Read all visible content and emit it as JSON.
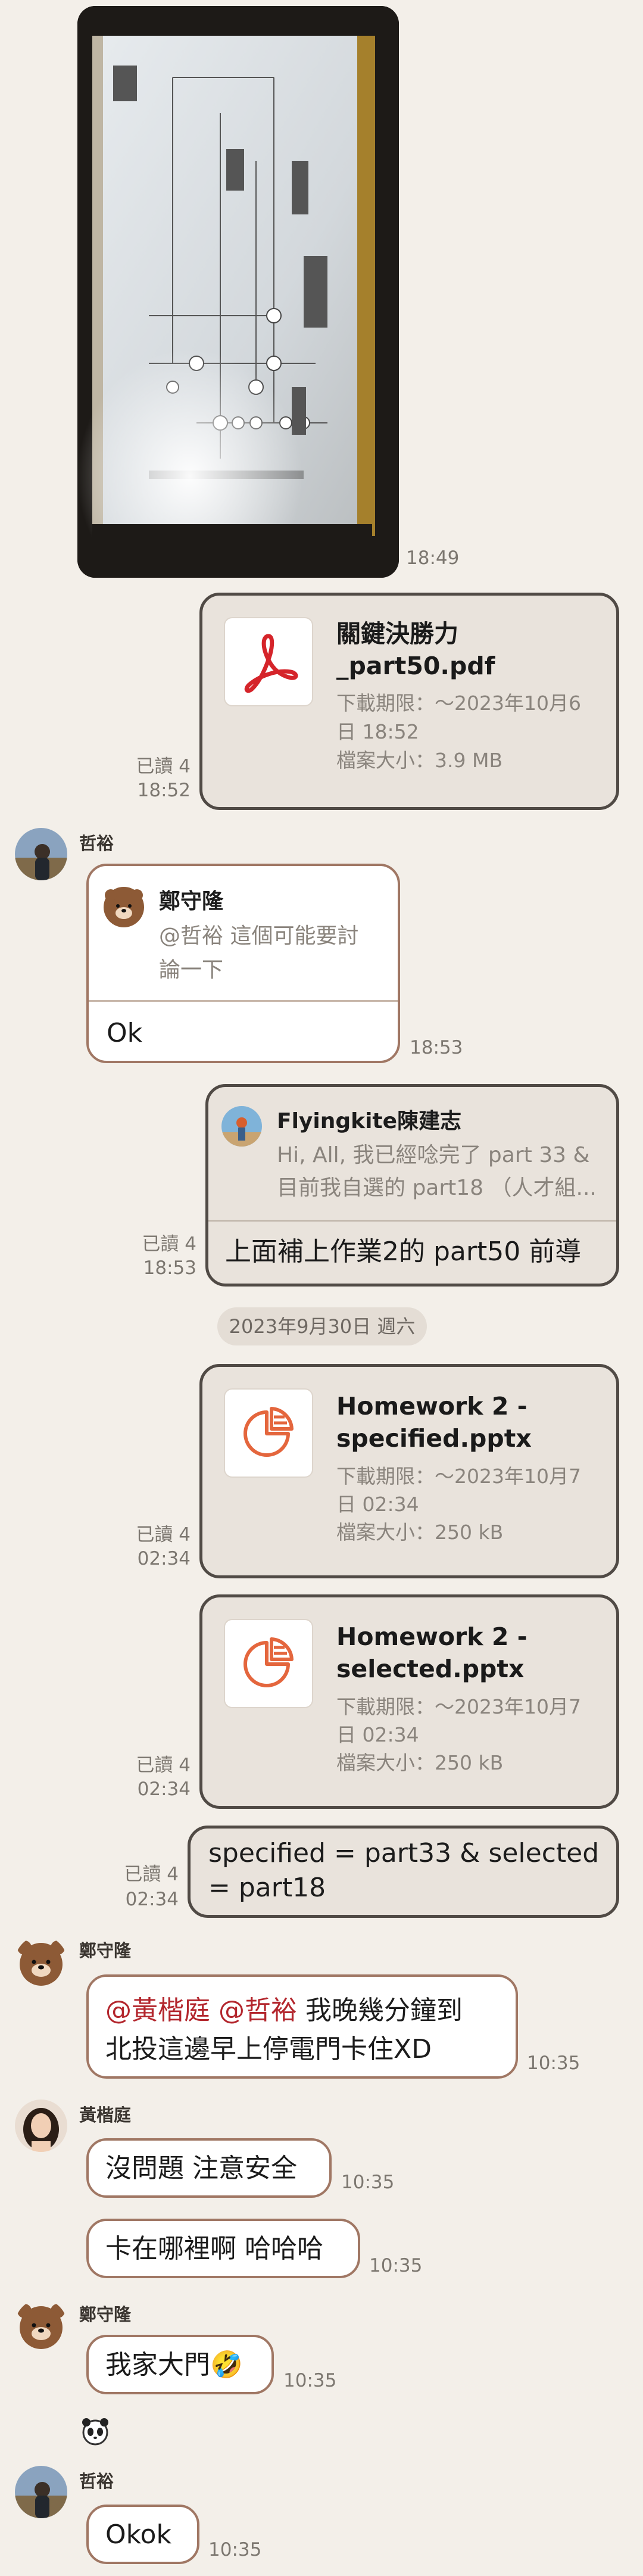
{
  "messages": {
    "photo": {
      "time": "18:49"
    },
    "pdf": {
      "read": "已讀 4",
      "time": "18:52",
      "title1": "關鍵決勝力",
      "title2": "_part50.pdf",
      "expiry1": "下載期限：～2023年10月6",
      "expiry2": "日 18:52",
      "size": "檔案大小：3.9 MB",
      "icon": "pdf-icon"
    },
    "zheyu_ok": {
      "sender": "哲裕",
      "quote_name": "鄭守隆",
      "quote_text1": "@哲裕 這個可能要討",
      "quote_text2": "論一下",
      "text": "Ok",
      "time": "18:53"
    },
    "reply_flying": {
      "read": "已讀 4",
      "time": "18:53",
      "quote_name": "Flyingkite陳建志",
      "quote_text1": "Hi, All, 我已經唸完了 part 33 &",
      "quote_text2": "目前我自選的 part18 （人才組...",
      "text": "上面補上作業2的 part50 前導"
    },
    "date_divider": "2023年9月30日 週六",
    "pptx1": {
      "read": "已讀 4",
      "time": "02:34",
      "title1": "Homework 2 -",
      "title2": "specified.pptx",
      "expiry1": "下載期限：～2023年10月7",
      "expiry2": "日 02:34",
      "size": "檔案大小：250 kB"
    },
    "pptx2": {
      "read": "已讀 4",
      "time": "02:34",
      "title1": "Homework 2 -",
      "title2": "selected.pptx",
      "expiry1": "下載期限：～2023年10月7",
      "expiry2": "日 02:34",
      "size": "檔案大小：250 kB"
    },
    "spec_text": {
      "read": "已讀 4",
      "time": "02:34",
      "line1": "specified = part33 & selected",
      "line2": "= part18"
    },
    "zheng1": {
      "sender": "鄭守隆",
      "mention1": "@黃楷庭",
      "mention2": "@哲裕",
      "line1_rest": " 我晚幾分鐘到",
      "line2": "北投這邊早上停電門卡住XD",
      "time": "10:35"
    },
    "huang": {
      "sender": "黃楷庭",
      "msg1": "沒問題 注意安全",
      "time1": "10:35",
      "msg2": "卡在哪裡啊 哈哈哈",
      "time2": "10:35"
    },
    "zheng2": {
      "sender": "鄭守隆",
      "text": "我家大門🤣",
      "time": "10:35"
    },
    "zheyu2": {
      "sender": "哲裕",
      "text": "Okok",
      "time": "10:35"
    }
  },
  "colors": {
    "background": "#f3efe9",
    "outgoing_bubble": "#e9e3dc",
    "outgoing_border": "#504a45",
    "incoming_border": "#a07764",
    "mention": "#b3262d",
    "pptx_orange": "#e4663d",
    "pdf_red": "#d5242a"
  }
}
